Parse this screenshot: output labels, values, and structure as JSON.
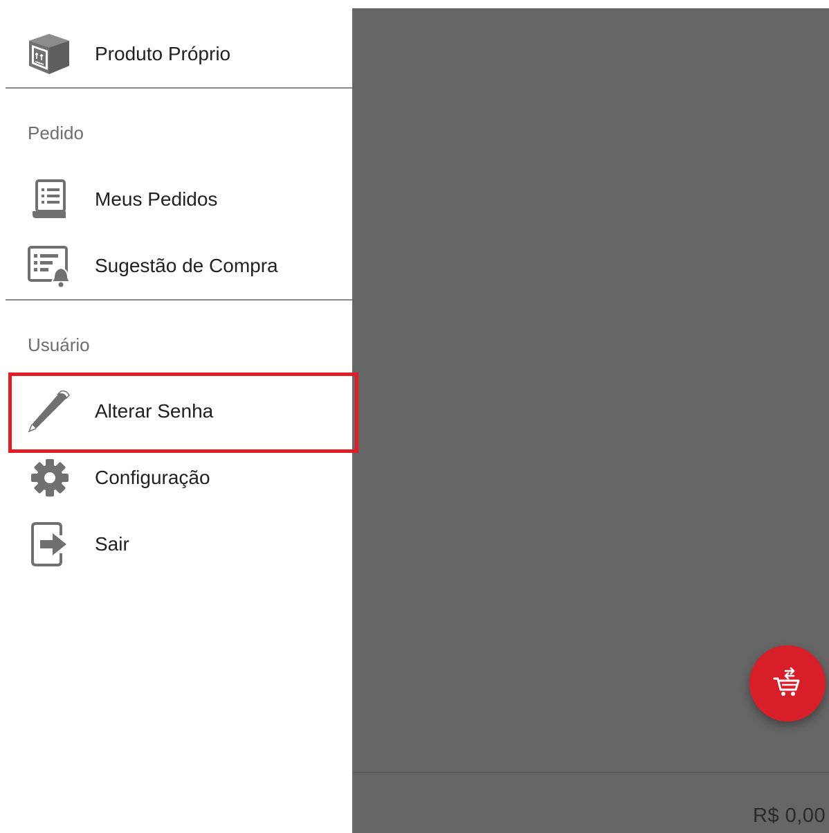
{
  "drawer": {
    "top_item": {
      "label": "Produto Próprio",
      "icon": "box-icon"
    },
    "sections": [
      {
        "header": "Pedido",
        "items": [
          {
            "label": "Meus Pedidos",
            "icon": "order-list-icon"
          },
          {
            "label": "Sugestão de Compra",
            "icon": "purchase-suggestion-icon"
          }
        ]
      },
      {
        "header": "Usuário",
        "items": [
          {
            "label": "Alterar Senha",
            "icon": "pencil-icon"
          },
          {
            "label": "Configuração",
            "icon": "gear-icon"
          },
          {
            "label": "Sair",
            "icon": "exit-icon"
          }
        ]
      }
    ]
  },
  "main": {
    "total": "R$ 0,00",
    "fab_icon": "cart-transfer-icon"
  },
  "colors": {
    "accent": "#d81e29",
    "highlight": "#e21d26",
    "icon": "#707070",
    "overlay": "#666666"
  }
}
